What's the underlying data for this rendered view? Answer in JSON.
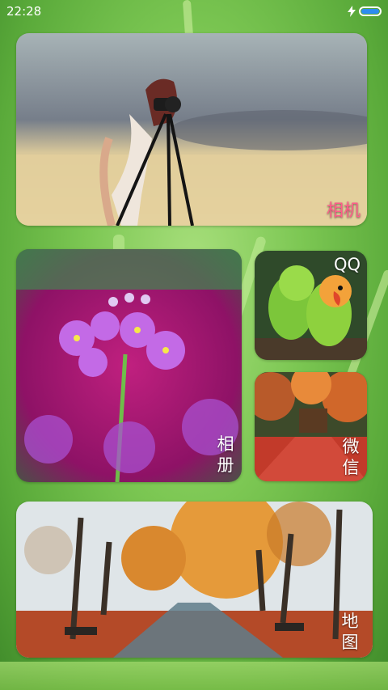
{
  "status_bar": {
    "time": "22:28",
    "battery_level": 1.0,
    "charging": true
  },
  "cards": {
    "camera": {
      "label": "相机",
      "label_color": "#ff5c8a"
    },
    "album": {
      "label": "相册"
    },
    "qq": {
      "label": "QQ"
    },
    "wechat": {
      "label": "微信"
    },
    "map": {
      "label": "地图"
    }
  },
  "colors": {
    "battery_fill": "#2d8cf0",
    "wallpaper": "#7cc753"
  }
}
